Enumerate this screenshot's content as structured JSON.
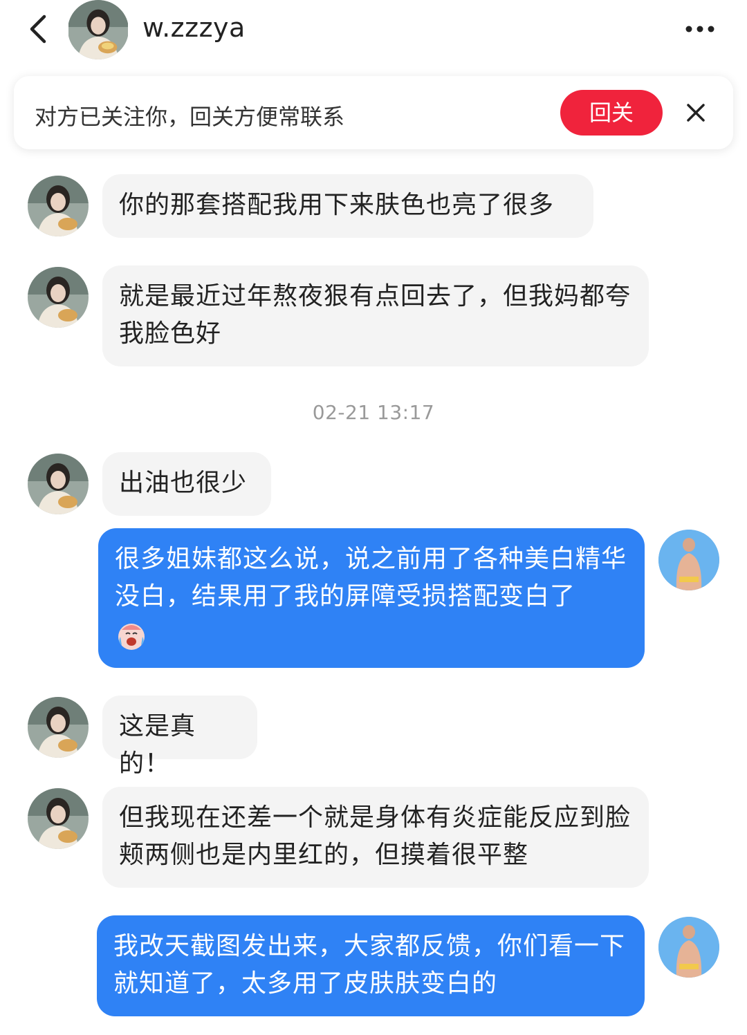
{
  "header": {
    "username": "w.zzzya"
  },
  "banner": {
    "text": "对方已关注你，回关方便常联系",
    "follow_label": "回关"
  },
  "timestamp": "02-21 13:17",
  "messages": [
    {
      "side": "in",
      "text": "你的那套搭配我用下来肤色也亮了很多"
    },
    {
      "side": "in",
      "text": "就是最近过年熬夜狠有点回去了，但我妈都夸我脸色好"
    },
    {
      "side": "in",
      "text": "出油也很少"
    },
    {
      "side": "out",
      "text": "很多姐妹都这么说，说之前用了各种美白精华没白，结果用了我的屏障受损搭配变白了",
      "emoji": "crying-laughing-emoji"
    },
    {
      "side": "in",
      "text": "这是真的！"
    },
    {
      "side": "in",
      "text": "但我现在还差一个就是身体有炎症能反应到脸颊两侧也是内里红的，但摸着很平整"
    },
    {
      "side": "out",
      "text": "我改天截图发出来，大家都反馈，你们看一下就知道了，太多用了皮肤肤变白的"
    }
  ],
  "colors": {
    "follow_button": "#f0233c",
    "outgoing_bubble": "#2f82f5",
    "incoming_bubble": "#f4f4f4"
  }
}
